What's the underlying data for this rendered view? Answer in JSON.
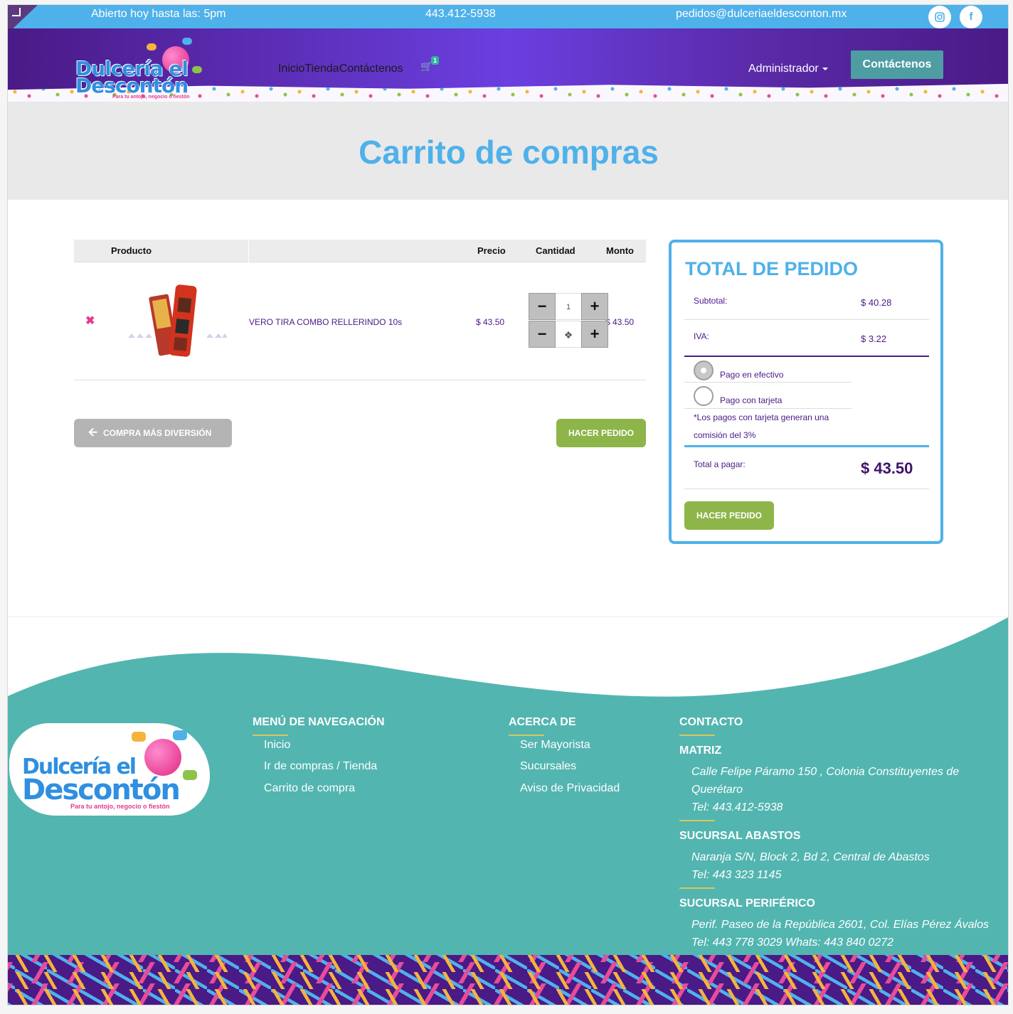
{
  "topbar": {
    "hours": "Abierto hoy hasta las: 5pm",
    "phone": "443.412-5938",
    "email": "pedidos@dulceriaeldesconton.mx",
    "instagram_icon": "instagram-icon",
    "facebook_icon": "facebook-icon"
  },
  "brand": {
    "logo_text_line1": "Dulcería el",
    "logo_text_line2": "Descontón",
    "tagline": "Para tu antojo, negocio o fiestón"
  },
  "nav": {
    "links": [
      "Inicio",
      "Tienda",
      "Contáctenos"
    ],
    "cart_count": "1",
    "admin_label": "Administrador",
    "contact_button": "Contáctenos"
  },
  "page": {
    "title": "Carrito de compras"
  },
  "cart": {
    "columns": {
      "product": "Producto",
      "price": "Precio",
      "quantity": "Cantidad",
      "amount": "Monto"
    },
    "items": [
      {
        "remove": "✖",
        "name": "VERO TIRA COMBO RELLERINDO 10s",
        "price": "$ 43.50",
        "quantity": "1",
        "amount": "$ 43.50"
      }
    ],
    "back_button": "COMPRA MÁS DIVERSIÓN",
    "order_button": "HACER PEDIDO"
  },
  "summary": {
    "title": "TOTAL DE PEDIDO",
    "subtotal_label": "Subtotal:",
    "subtotal_value": "$ 40.28",
    "iva_label": "IVA:",
    "iva_value": "$ 3.22",
    "payment_options": [
      "Pago en efectivo",
      "Pago con tarjeta"
    ],
    "selected_payment": "Pago en efectivo",
    "card_note": "*Los pagos con tarjeta generan una comisión del 3%",
    "total_label": "Total a pagar:",
    "total_value": "$ 43.50",
    "order_button": "HACER PEDIDO"
  },
  "footer": {
    "nav_title": "MENÚ DE NAVEGACIÓN",
    "nav_links": [
      "Inicio",
      "Ir de compras / Tienda",
      "Carrito de compra"
    ],
    "about_title": "ACERCA DE",
    "about_links": [
      "Ser Mayorista",
      "Sucursales",
      "Aviso de Privacidad"
    ],
    "contact_title": "CONTACTO",
    "branches": [
      {
        "name": "MATRIZ",
        "address": "Calle Felipe Páramo 150 , Colonia Constituyentes de Querétaro",
        "phone": "Tel: 443.412-5938"
      },
      {
        "name": "SUCURSAL ABASTOS",
        "address": "Naranja S/N, Block 2, Bd 2, Central de Abastos",
        "phone": "Tel: 443 323 1145"
      },
      {
        "name": "SUCURSAL PERIFÉRICO",
        "address": "Perif. Paseo de la República 2601, Col. Elías Pérez Ávalos",
        "phone": "Tel: 443 778 3029 Whats: 443 840 0272"
      }
    ]
  },
  "colors": {
    "topbar": "#4fb1ea",
    "nav_purple": "#4a1a86",
    "title_blue": "#4fb1ea",
    "order_green": "#8db54a",
    "footer_teal": "#53b5b0"
  }
}
